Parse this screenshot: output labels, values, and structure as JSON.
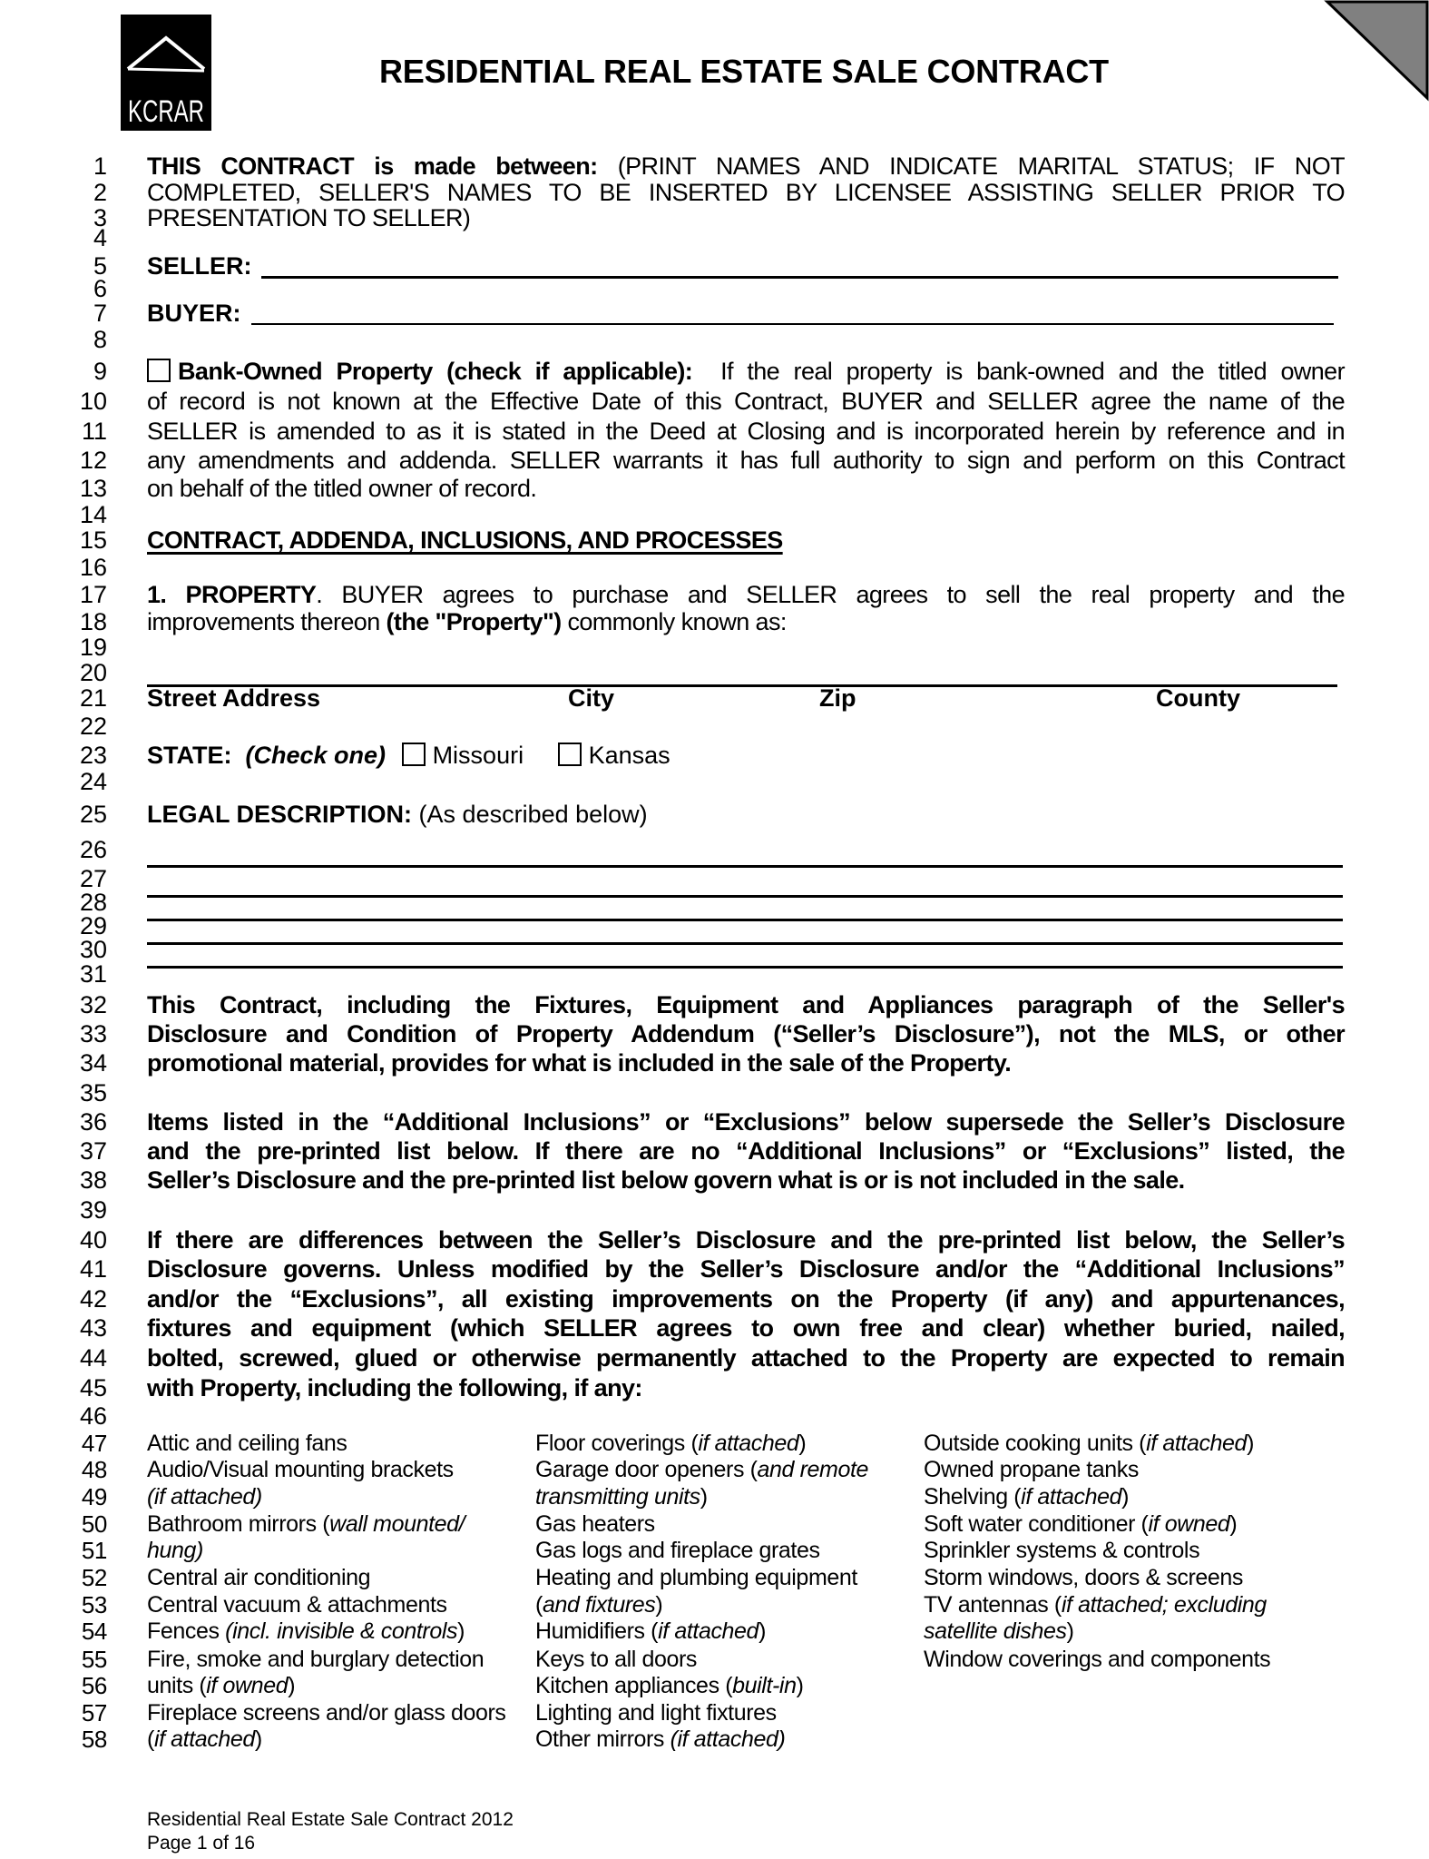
{
  "header": {
    "logo_text": "KCRAR",
    "title": "RESIDENTIAL REAL ESTATE SALE CONTRACT",
    "corner_fold_color": "#808080"
  },
  "line_numbers": [
    "1",
    "2",
    "3",
    "4",
    "5",
    "6",
    "7",
    "8",
    "9",
    "10",
    "11",
    "12",
    "13",
    "14",
    "15",
    "16",
    "17",
    "18",
    "19",
    "20",
    "21",
    "22",
    "23",
    "24",
    "25",
    "26",
    "27",
    "28",
    "29",
    "30",
    "31",
    "32",
    "33",
    "34",
    "35",
    "36",
    "37",
    "38",
    "39",
    "40",
    "41",
    "42",
    "43",
    "44",
    "45",
    "46",
    "47",
    "48",
    "49",
    "50",
    "51",
    "52",
    "53",
    "54",
    "55",
    "56",
    "57",
    "58"
  ],
  "parties": {
    "intro_bold": "THIS CONTRACT is made between:",
    "intro_line1_rest": "(PRINT NAMES AND INDICATE MARITAL STATUS; IF NOT",
    "intro_line2": "COMPLETED, SELLER'S NAMES TO BE INSERTED BY LICENSEE ASSISTING SELLER PRIOR TO",
    "intro_line3": "PRESENTATION TO SELLER)",
    "seller_label": "SELLER:",
    "seller_value": "",
    "buyer_label": "BUYER:",
    "buyer_value": ""
  },
  "bank_owned": {
    "checked": false,
    "label": "Bank-Owned Property (check if applicable):",
    "line9_rest": "If the real property is bank-owned and the titled owner",
    "line10": "of record is not known at the Effective Date of this Contract, BUYER and SELLER agree the name of the",
    "line11": "SELLER is amended to as it is stated in the Deed at Closing and is incorporated herein by reference and in",
    "line12": "any amendments and addenda.  SELLER warrants it has full authority to sign and perform on this Contract",
    "line13": "on behalf of the titled owner of record."
  },
  "section_heading": "CONTRACT, ADDENDA, INCLUSIONS, AND PROCESSES",
  "property": {
    "number_label": "1. PROPERTY",
    "line17_rest": ". BUYER agrees to purchase and SELLER agrees to sell the real property and the",
    "line18_pre": "improvements thereon ",
    "line18_bold": "(the \"Property\")",
    "line18_post": " commonly known as:",
    "address_value": "",
    "address_labels": {
      "street": "Street Address",
      "city": "City",
      "zip": "Zip",
      "county": "County"
    },
    "state_label": "STATE:",
    "state_hint": "(Check one)",
    "state_options": [
      {
        "label": "Missouri",
        "checked": false
      },
      {
        "label": "Kansas",
        "checked": false
      }
    ],
    "legal_label": "LEGAL DESCRIPTION:",
    "legal_hint": "(As described below)",
    "legal_lines": [
      "",
      "",
      "",
      "",
      ""
    ]
  },
  "paragraphs": {
    "p32": "This Contract, including the Fixtures, Equipment and Appliances paragraph of the Seller's",
    "p33": "Disclosure and Condition of Property Addendum (“Seller’s Disclosure”), not the MLS, or other",
    "p34": "promotional material, provides for what is included in the sale of the Property.",
    "p36": "Items listed in the “Additional Inclusions” or “Exclusions” below supersede the Seller’s Disclosure",
    "p37": "and the pre-printed list below.  If there are no “Additional Inclusions” or “Exclusions” listed, the",
    "p38": "Seller’s Disclosure and the pre-printed list below govern what is or is not included in the sale.",
    "p40": "If there are differences between the Seller’s Disclosure and the pre-printed list below, the Seller’s",
    "p41": "Disclosure governs.  Unless modified by the Seller’s Disclosure and/or the “Additional Inclusions”",
    "p42": "and/or the “Exclusions”, all existing improvements on the Property (if any) and appurtenances,",
    "p43": "fixtures and equipment (which SELLER agrees to own free and clear) whether buried, nailed,",
    "p44": "bolted, screwed, glued or otherwise permanently attached to the Property are expected to remain",
    "p45": "with Property, including the following, if any:"
  },
  "inclusions": {
    "col1": [
      {
        "t": "Attic and ceiling fans",
        "i": ""
      },
      {
        "t": "Audio/Visual mounting brackets",
        "i": ""
      },
      {
        "t": "",
        "i": "(if attached)",
        "post": ""
      },
      {
        "t": "Bathroom mirrors (",
        "i": "wall mounted/",
        "post": ""
      },
      {
        "t": "",
        "i": "hung)",
        "post": ""
      },
      {
        "t": "Central air conditioning",
        "i": ""
      },
      {
        "t": "Central vacuum & attachments",
        "i": ""
      },
      {
        "t": "Fences ",
        "i": "(incl. invisible & controls",
        "post": ")"
      },
      {
        "t": "Fire, smoke and burglary detection",
        "i": ""
      },
      {
        "t": "units (",
        "i": "if owned",
        "post": ")"
      },
      {
        "t": "Fireplace screens and/or glass doors",
        "i": ""
      },
      {
        "t": "(",
        "i": "if attached",
        "post": ")"
      }
    ],
    "col2": [
      {
        "t": "Floor coverings (",
        "i": "if attached",
        "post": ")"
      },
      {
        "t": "Garage door openers (",
        "i": "and remote",
        "post": ""
      },
      {
        "t": "",
        "i": "transmitting units",
        "post": ")"
      },
      {
        "t": "Gas heaters",
        "i": ""
      },
      {
        "t": "Gas logs and fireplace grates",
        "i": ""
      },
      {
        "t": "Heating and plumbing equipment",
        "i": ""
      },
      {
        "t": "(",
        "i": "and fixtures",
        "post": ")"
      },
      {
        "t": "Humidifiers (",
        "i": "if attached",
        "post": ")"
      },
      {
        "t": "Keys to all doors",
        "i": ""
      },
      {
        "t": "Kitchen appliances (",
        "i": "built-in",
        "post": ")"
      },
      {
        "t": "Lighting and light fixtures",
        "i": ""
      },
      {
        "t": "Other mirrors ",
        "i": "(if attached)",
        "post": ""
      }
    ],
    "col3": [
      {
        "t": "Outside cooking units (",
        "i": "if attached",
        "post": ")"
      },
      {
        "t": "Owned propane tanks",
        "i": ""
      },
      {
        "t": "Shelving (",
        "i": "if attached",
        "post": ")"
      },
      {
        "t": "Soft water conditioner (",
        "i": "if owned",
        "post": ")"
      },
      {
        "t": "Sprinkler systems & controls",
        "i": ""
      },
      {
        "t": "Storm windows, doors & screens",
        "i": ""
      },
      {
        "t": "TV antennas (",
        "i": "if attached; excluding",
        "post": ""
      },
      {
        "t": "",
        "i": "satellite dishes",
        "post": ")"
      },
      {
        "t": "Window coverings and components",
        "i": ""
      }
    ]
  },
  "footer": {
    "doc_name": "Residential Real Estate Sale Contract 2012",
    "page": "Page 1 of 16"
  }
}
